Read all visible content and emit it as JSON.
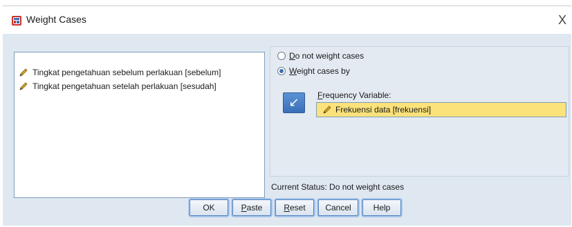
{
  "window": {
    "title": "Weight Cases",
    "close_glyph": "X"
  },
  "variables": [
    {
      "label": "Tingkat pengetahuan sebelum perlakuan [sebelum]",
      "icon": "pencil-icon"
    },
    {
      "label": "Tingkat pengetahuan setelah perlakuan [sesudah]",
      "icon": "pencil-icon"
    }
  ],
  "options": {
    "do_not_weight": {
      "first": "D",
      "rest": "o not weight cases",
      "selected": false
    },
    "weight_by": {
      "first": "W",
      "rest": "eight cases by",
      "selected": true
    }
  },
  "frequency": {
    "label_first": "F",
    "label_rest": "requency Variable:",
    "value": "Frekuensi data [frekuensi]",
    "move_arrow": "↙"
  },
  "status": {
    "text": "Current Status: Do not weight cases"
  },
  "buttons": {
    "ok": "OK",
    "paste_first": "P",
    "paste_rest": "aste",
    "reset_first": "R",
    "reset_rest": "eset",
    "cancel": "Cancel",
    "help": "Help"
  },
  "colors": {
    "field_highlight": "#fbe27a",
    "accent": "#3a6fb8",
    "dialog_bg": "#dfe8f1"
  }
}
